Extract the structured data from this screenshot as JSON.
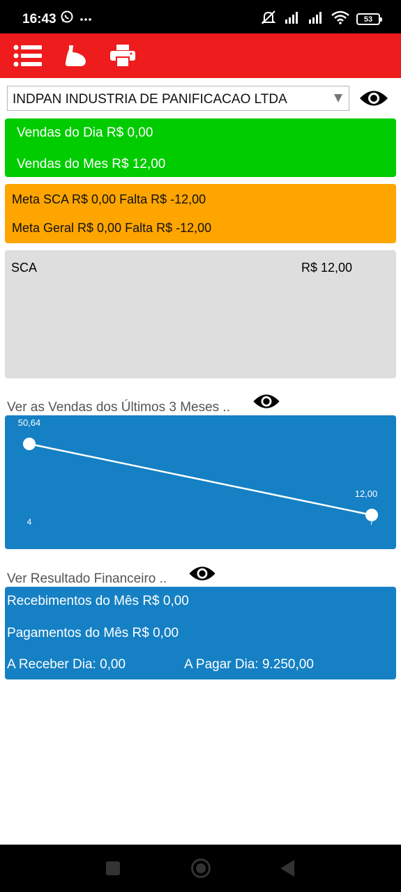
{
  "status_bar": {
    "time": "16:43",
    "battery": "53",
    "left_icons": [
      "whatsapp-icon",
      "more-icon"
    ],
    "right_icons": [
      "mute-icon",
      "signal-icon",
      "signal-icon",
      "wifi-icon",
      "battery-icon"
    ]
  },
  "toolbar": {
    "color": "#ee1c1c",
    "icons": [
      "list-menu-icon",
      "flexed-arm-icon",
      "printer-icon"
    ]
  },
  "company_select": {
    "selected": "INDPAN INDUSTRIA DE PANIFICACAO LTDA"
  },
  "sales_card": {
    "color": "#00cc00",
    "day": "Vendas do Dia R$ 0,00",
    "month": "Vendas do Mes R$ 12,00"
  },
  "goals_card": {
    "color": "#ffa500",
    "sca": "Meta SCA R$ 0,00 Falta R$ -12,00",
    "general": "Meta Geral R$ 0,00 Falta R$ -12,00"
  },
  "breakdown_card": {
    "rows": [
      {
        "label": "SCA",
        "value": "R$ 12,00"
      }
    ]
  },
  "sales_chart_section": {
    "label": "Ver as Vendas dos Últimos 3 Meses .."
  },
  "chart_data": {
    "type": "line",
    "x": [
      "4",
      "7"
    ],
    "series": [
      {
        "values": [
          50.64,
          12.0
        ]
      }
    ],
    "data_labels": [
      "50,64",
      "12,00"
    ],
    "x_tick_labels": [
      "4",
      "7"
    ],
    "title": "",
    "xlabel": "",
    "ylabel": "",
    "background": "#1580c4",
    "line_color": "#ffffff",
    "grid": false
  },
  "finance_section": {
    "label": "Ver Resultado Financeiro ..",
    "receipts": "Recebimentos do Mês R$ 0,00",
    "payments": "Pagamentos do Mês R$ 0,00",
    "receivable_day": "A Receber Dia: 0,00",
    "payable_day": "A Pagar Dia: 9.250,00"
  },
  "nav_bar": {
    "buttons": [
      "recents-square-icon",
      "home-circle-icon",
      "back-triangle-icon"
    ]
  }
}
